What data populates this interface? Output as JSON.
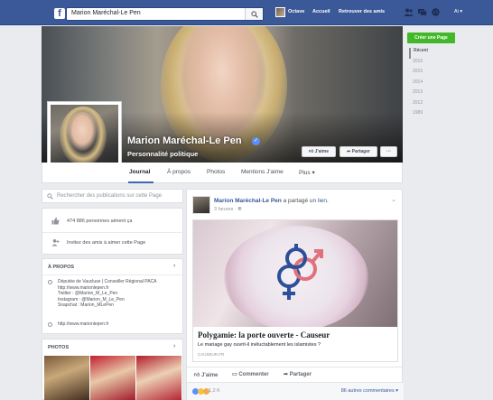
{
  "topbar": {
    "logo": "f",
    "search_value": "Marion Maréchal-Le Pen",
    "user_name": "Octave",
    "home_label": "Accueil",
    "find_friends_label": "Retrouver des amis",
    "lang_label": "Ai"
  },
  "sidebar_right": {
    "create_page_label": "Créer une Page",
    "years": [
      "Récent",
      "2016",
      "2015",
      "2014",
      "2013",
      "2012",
      "1989"
    ]
  },
  "profile": {
    "name": "Marion Maréchal-Le Pen",
    "category": "Personnalité politique",
    "like_button": "J'aime",
    "share_button": "Partager",
    "more_button": "···"
  },
  "tabs": [
    "Journal",
    "À propos",
    "Photos",
    "Mentions J'aime",
    "Plus"
  ],
  "left": {
    "search_placeholder": "Rechercher des publications sur cette Page",
    "likes_text": "474 886 personnes aiment ça",
    "invite_text": "Invitez des amis à aimer cette Page",
    "about_header": "À PROPOS",
    "about_lines": [
      "Députée de Vaucluse | Conseiller Régional PACA",
      "http://www.marionlepen.fr",
      "Twitter : @Marion_M_Le_Pen",
      "Instagram : @Marion_M_Le_Pen",
      "Snapchat : Marion_MLePen"
    ],
    "about_link": "http://www.marionlepen.fr",
    "photos_header": "PHOTOS"
  },
  "post": {
    "author": "Marion Maréchal-Le Pen",
    "action": " a partagé un ",
    "action_link": "lien",
    "time": "3 heures",
    "link_title": "Polygamie: la porte ouverte - Causeur",
    "link_description": "Le mariage gay ouvrit-il inéluctablement les islamistes ?",
    "link_domain": "causeur.fr",
    "like": "J'aime",
    "comment": "Commenter",
    "share": "Partager",
    "reactions_count": "1,2 K",
    "comments_link": "86 autres commentaires"
  },
  "colors": {
    "brand": "#3b5998",
    "create_page": "#42b72a",
    "link": "#365899"
  }
}
